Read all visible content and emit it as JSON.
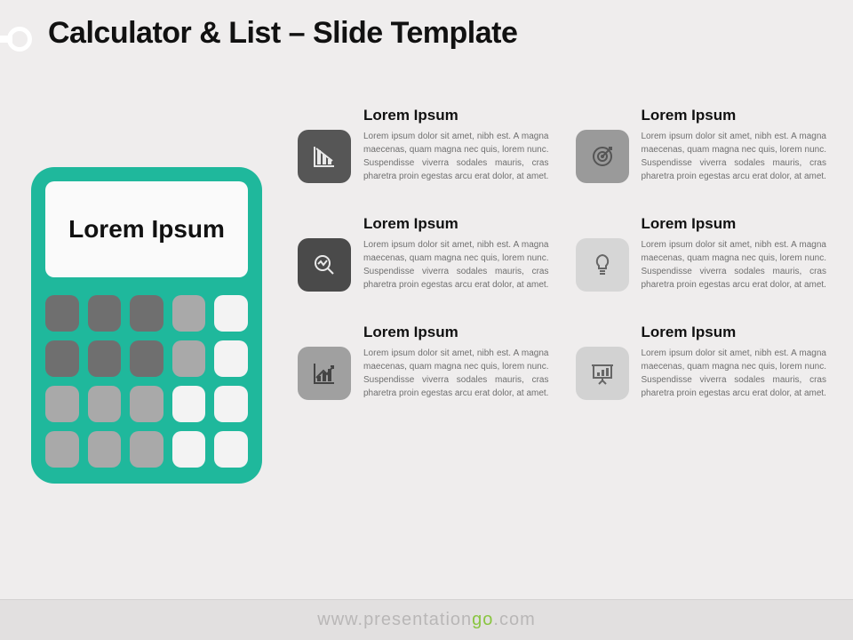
{
  "title": "Calculator & List – Slide Template",
  "calculator": {
    "screen_text": "Lorem Ipsum"
  },
  "items": [
    {
      "title": "Lorem Ipsum",
      "body": "Lorem ipsum dolor sit amet, nibh est. A magna maecenas, quam magna nec quis, lorem nunc. Suspendisse viverra sodales mauris, cras pharetra proin egestas arcu erat dolor, at amet."
    },
    {
      "title": "Lorem Ipsum",
      "body": "Lorem ipsum dolor sit amet, nibh est. A magna maecenas, quam magna nec quis, lorem nunc. Suspendisse viverra sodales mauris, cras pharetra proin egestas arcu erat dolor, at amet."
    },
    {
      "title": "Lorem Ipsum",
      "body": "Lorem ipsum dolor sit amet, nibh est. A magna maecenas, quam magna nec quis, lorem nunc. Suspendisse viverra sodales mauris, cras pharetra proin egestas arcu erat dolor, at amet."
    },
    {
      "title": "Lorem Ipsum",
      "body": "Lorem ipsum dolor sit amet, nibh est. A magna maecenas, quam magna nec quis, lorem nunc. Suspendisse viverra sodales mauris, cras pharetra proin egestas arcu erat dolor, at amet."
    },
    {
      "title": "Lorem Ipsum",
      "body": "Lorem ipsum dolor sit amet, nibh est. A magna maecenas, quam magna nec quis, lorem nunc. Suspendisse viverra sodales mauris, cras pharetra proin egestas arcu erat dolor, at amet."
    },
    {
      "title": "Lorem Ipsum",
      "body": "Lorem ipsum dolor sit amet, nibh est. A magna maecenas, quam magna nec quis, lorem nunc. Suspendisse viverra sodales mauris, cras pharetra proin egestas arcu erat dolor, at amet."
    }
  ],
  "footer": {
    "prefix": "www.",
    "mid": "presentation",
    "accent": "go",
    "suffix": ".com"
  }
}
